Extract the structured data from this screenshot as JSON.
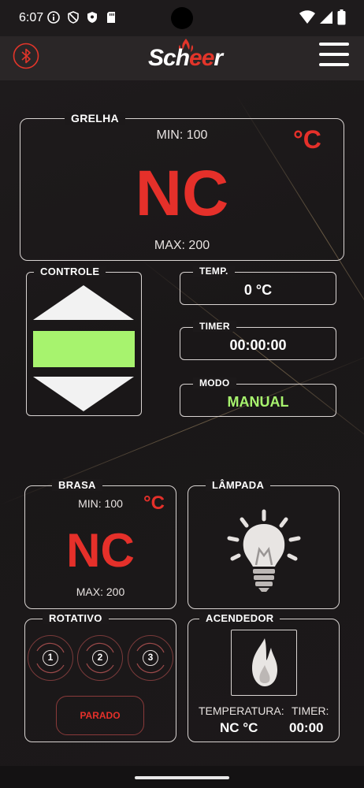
{
  "status_bar": {
    "time": "6:07"
  },
  "app": {
    "logo_pre": "Sch",
    "logo_ee": "ee",
    "logo_post": "r"
  },
  "grelha": {
    "title": "GRELHA",
    "min": "MIN: 100",
    "max": "MAX: 200",
    "value": "NC",
    "unit": "°C"
  },
  "controle": {
    "title": "CONTROLE"
  },
  "temp": {
    "title": "TEMP.",
    "value": "0 °C"
  },
  "timer": {
    "title": "TIMER",
    "value": "00:00:00"
  },
  "modo": {
    "title": "MODO",
    "value": "MANUAL"
  },
  "brasa": {
    "title": "BRASA",
    "min": "MIN: 100",
    "max": "MAX: 200",
    "value": "NC",
    "unit": "°C"
  },
  "lampada": {
    "title": "LÂMPADA"
  },
  "rotativo": {
    "title": "ROTATIVO",
    "speeds": [
      "1",
      "2",
      "3"
    ],
    "status_button": "PARADO"
  },
  "acendedor": {
    "title": "ACENDEDOR",
    "temp_label": "TEMPERATURA:",
    "temp_value": "NC °C",
    "timer_label": "TIMER:",
    "timer_value": "00:00"
  },
  "colors": {
    "accent_red": "#e5302a",
    "mode_green": "#a7f36e",
    "control_bar_green": "#a7f36e"
  }
}
